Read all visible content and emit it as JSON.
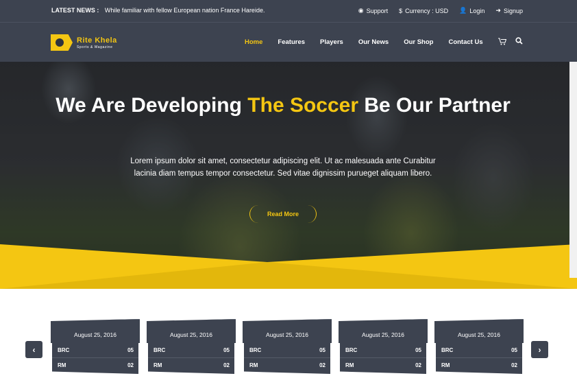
{
  "topbar": {
    "news_label": "LATEST NEWS :",
    "news_text": "While familiar with fellow European nation France Hareide.",
    "links": [
      {
        "icon": "globe-icon",
        "glyph": "◉",
        "label": "Support"
      },
      {
        "icon": "dollar-icon",
        "glyph": "$",
        "label": "Currency : USD"
      },
      {
        "icon": "user-icon",
        "glyph": "👤",
        "label": "Login"
      },
      {
        "icon": "signin-icon",
        "glyph": "➜",
        "label": "Signup"
      }
    ]
  },
  "brand": {
    "name": "Rite Khela",
    "tagline": "Sports & Magazine"
  },
  "nav": {
    "items": [
      "Home",
      "Features",
      "Players",
      "Our News",
      "Our Shop",
      "Contact Us"
    ],
    "active_index": 0,
    "cart_icon": "🛒",
    "search_icon": "🔍"
  },
  "hero": {
    "title_before": "We Are Developing ",
    "title_highlight": "The Soccer",
    "title_after": " Be Our Partner",
    "text": "Lorem ipsum dolor sit amet, consectetur adipiscing elit. Ut ac malesuada ante Curabitur lacinia diam tempus tempor consectetur. Sed vitae dignissim purueget aliquam libero.",
    "button": "Read More"
  },
  "matches": {
    "prev": "‹",
    "next": "›",
    "cards": [
      {
        "date": "August 25, 2016",
        "team1": "BRC",
        "score1": "05",
        "team2": "RM",
        "score2": "02"
      },
      {
        "date": "August 25, 2016",
        "team1": "BRC",
        "score1": "05",
        "team2": "RM",
        "score2": "02"
      },
      {
        "date": "August 25, 2016",
        "team1": "BRC",
        "score1": "05",
        "team2": "RM",
        "score2": "02"
      },
      {
        "date": "August 25, 2016",
        "team1": "BRC",
        "score1": "05",
        "team2": "RM",
        "score2": "02"
      },
      {
        "date": "August 25, 2016",
        "team1": "BRC",
        "score1": "05",
        "team2": "RM",
        "score2": "02"
      }
    ]
  },
  "colors": {
    "accent": "#f4c612",
    "dark": "#3d4350"
  }
}
